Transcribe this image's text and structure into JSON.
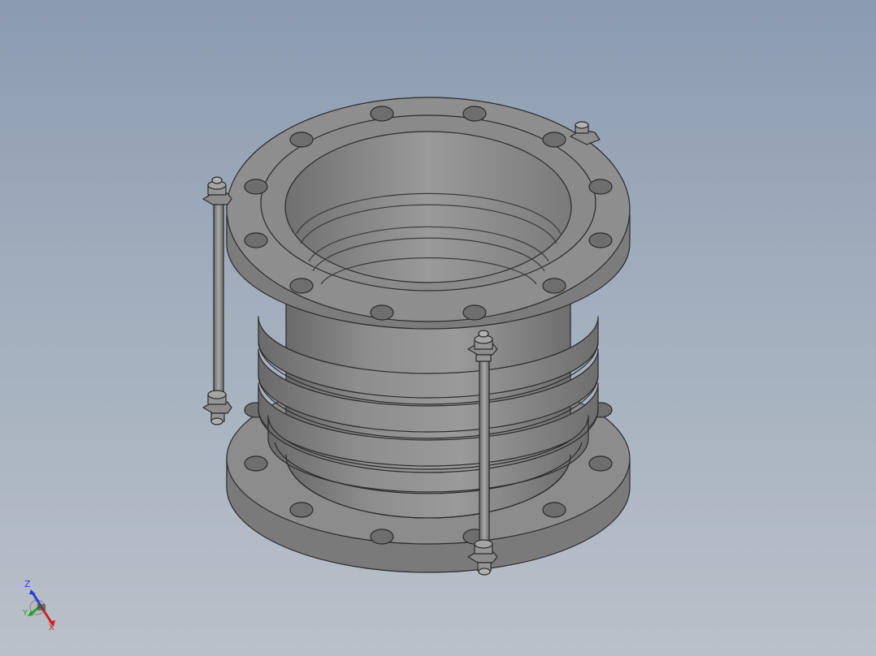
{
  "viewport": {
    "background_top": "#8b9bb0",
    "background_bottom": "#b9c0c9"
  },
  "model": {
    "part_name": "expansion-joint-assembly",
    "color": "#8a8a8a",
    "edge_color": "#2a2a2a"
  },
  "triad": {
    "z_label": "Z",
    "y_label": "Y",
    "x_label": "X",
    "z_color": "#2a3fd0",
    "y_color": "#2aa12a",
    "x_color": "#d02222"
  }
}
